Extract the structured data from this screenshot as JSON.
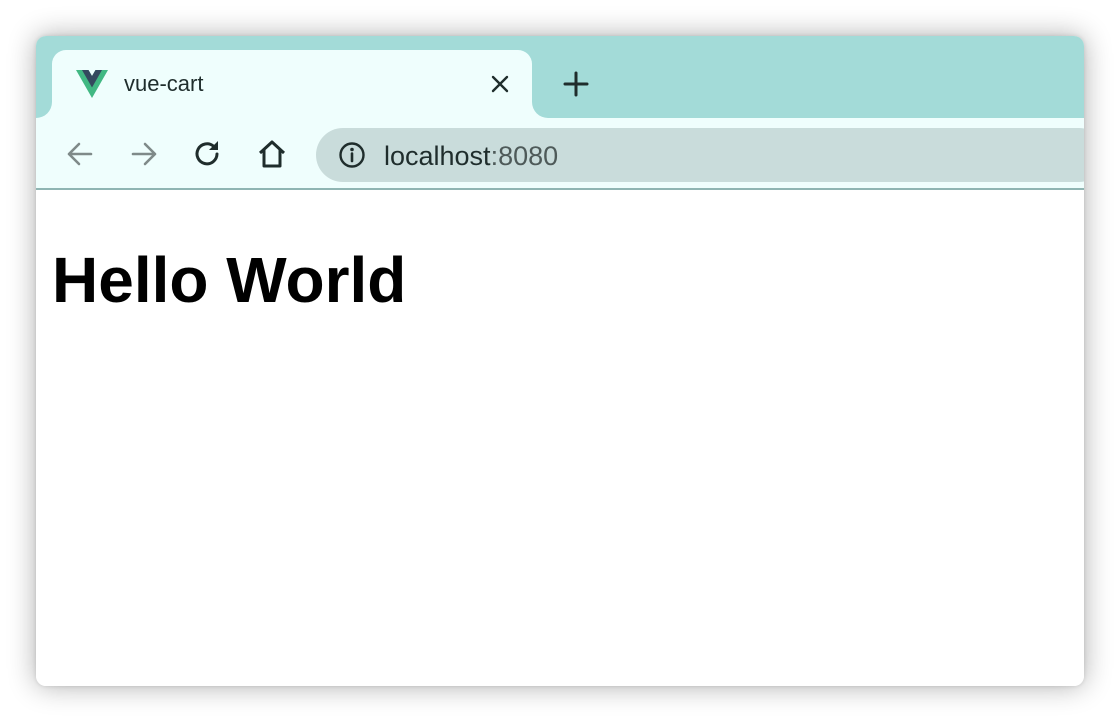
{
  "browser": {
    "tab": {
      "title": "vue-cart",
      "favicon": "vue-logo-icon",
      "close_icon": "close-icon"
    },
    "new_tab_icon": "plus-icon",
    "toolbar": {
      "back_icon": "arrow-left-icon",
      "forward_icon": "arrow-right-icon",
      "reload_icon": "reload-icon",
      "home_icon": "home-icon"
    },
    "address_bar": {
      "security_icon": "info-icon",
      "host": "localhost",
      "port": ":8080"
    }
  },
  "page": {
    "heading": "Hello World"
  },
  "colors": {
    "tab_strip": "#a3dbd8",
    "active_tab": "#effefd",
    "address_bar": "#c9dcdb",
    "vue_green": "#41b883",
    "vue_dark": "#34495e"
  }
}
